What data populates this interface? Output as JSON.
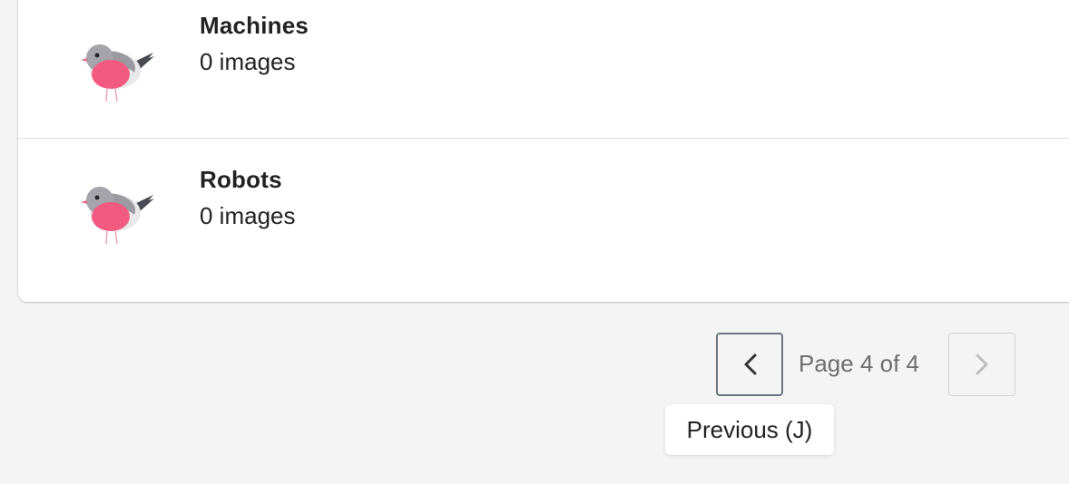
{
  "collections": [
    {
      "name": "Machines",
      "count": "0 images",
      "thumbnail": "robin-bird-icon"
    },
    {
      "name": "Robots",
      "count": "0 images",
      "thumbnail": "robin-bird-icon"
    }
  ],
  "pagination": {
    "prev_icon": "chevron-left-icon",
    "next_icon": "chevron-right-icon",
    "page_label": "Page 4 of 4",
    "tooltip": "Previous (J)",
    "next_disabled": true
  },
  "colors": {
    "background": "#f4f4f4",
    "card": "#ffffff",
    "bird_breast": "#f25a82",
    "bird_body": "#9a9aa0"
  }
}
